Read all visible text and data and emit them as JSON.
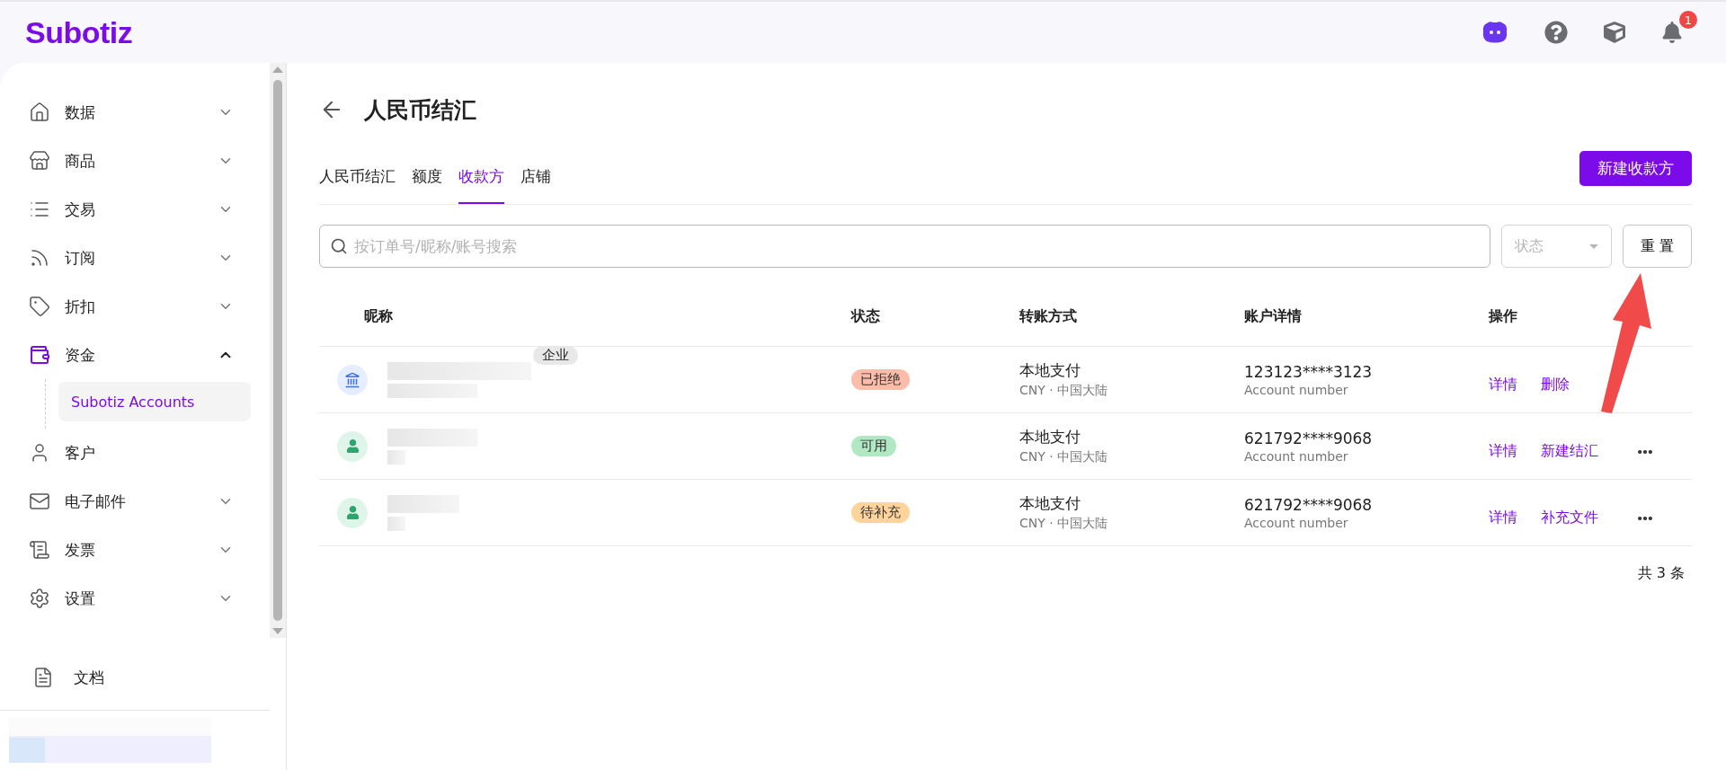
{
  "brand": "Subotiz",
  "header": {
    "notification_badge": "1"
  },
  "sidebar": {
    "items": [
      {
        "label": "数据",
        "expanded": false,
        "selected": false
      },
      {
        "label": "商品",
        "expanded": false,
        "selected": false
      },
      {
        "label": "交易",
        "expanded": false,
        "selected": false
      },
      {
        "label": "订阅",
        "expanded": false,
        "selected": false
      },
      {
        "label": "折扣",
        "expanded": false,
        "selected": false
      },
      {
        "label": "资金",
        "expanded": true,
        "selected": true,
        "children": [
          {
            "label": "Subotiz Accounts",
            "selected": true
          }
        ]
      },
      {
        "label": "客户",
        "selected": false
      },
      {
        "label": "电子邮件",
        "expanded": false,
        "selected": false
      },
      {
        "label": "发票",
        "expanded": false,
        "selected": false
      },
      {
        "label": "设置",
        "expanded": false,
        "selected": false
      }
    ],
    "footer_item": {
      "label": "文档"
    }
  },
  "page": {
    "title": "人民币结汇",
    "tabs": [
      {
        "label": "人民币结汇",
        "selected": false
      },
      {
        "label": "额度",
        "selected": false
      },
      {
        "label": "收款方",
        "selected": true
      },
      {
        "label": "店铺",
        "selected": false
      }
    ],
    "primary_button": "新建收款方",
    "search": {
      "placeholder": "按订单号/昵称/账号搜索"
    },
    "status_filter": {
      "placeholder": "状态"
    },
    "reset_button": "重 置",
    "table": {
      "columns": [
        "昵称",
        "状态",
        "转账方式",
        "账户详情",
        "操作"
      ],
      "rows": [
        {
          "kind": "company",
          "tag": "企业",
          "status": {
            "label": "已拒绝",
            "kind": "rejected"
          },
          "method": "本地支付",
          "region": "CNY · 中国大陆",
          "account": "123123****3123",
          "account_label": "Account number",
          "actions": [
            "详情",
            "删除"
          ]
        },
        {
          "kind": "person",
          "status": {
            "label": "可用",
            "kind": "available"
          },
          "method": "本地支付",
          "region": "CNY · 中国大陆",
          "account": "621792****9068",
          "account_label": "Account number",
          "actions": [
            "详情",
            "新建结汇"
          ],
          "more": true
        },
        {
          "kind": "person",
          "status": {
            "label": "待补充",
            "kind": "pending"
          },
          "method": "本地支付",
          "region": "CNY · 中国大陆",
          "account": "621792****9068",
          "account_label": "Account number",
          "actions": [
            "详情",
            "补充文件"
          ],
          "more": true
        }
      ]
    },
    "total": "共 3 条"
  }
}
